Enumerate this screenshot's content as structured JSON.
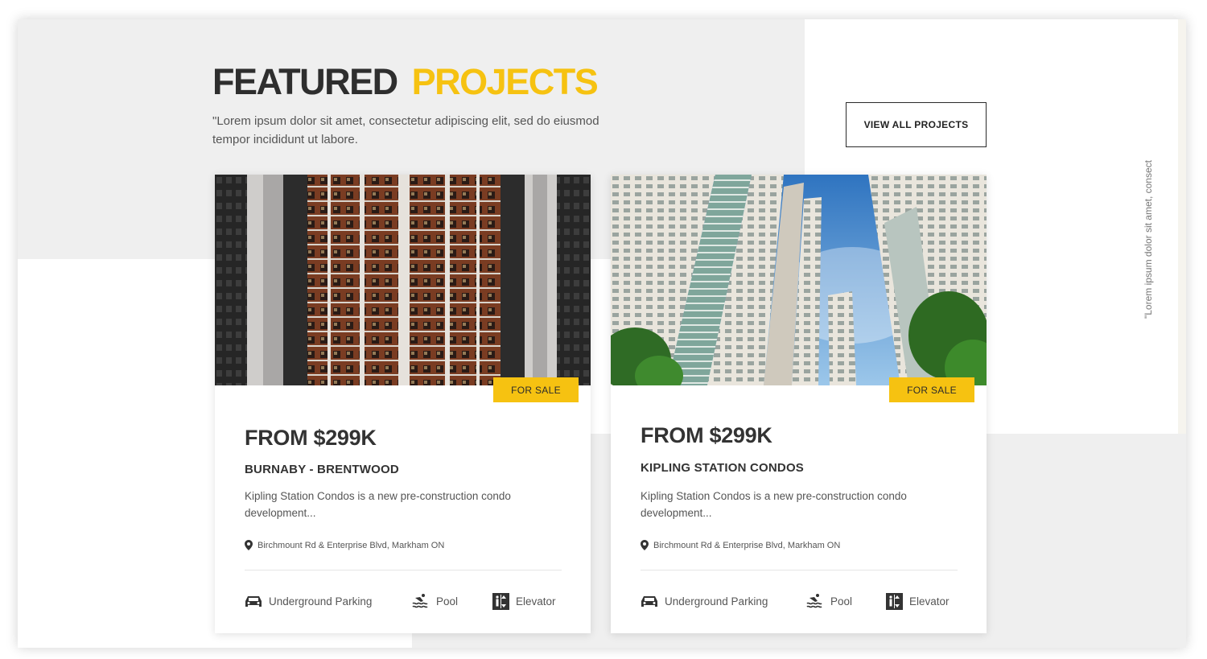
{
  "header": {
    "title_part1": "FEATURED",
    "title_part2": "PROJECTS",
    "subtitle": "\"Lorem ipsum dolor sit amet, consectetur adipiscing elit, sed do eiusmod tempor incididunt ut labore.",
    "view_all_label": "VIEW ALL PROJECTS"
  },
  "side_text": "\"Lorem ipsum dolor sit amet, consect",
  "colors": {
    "accent": "#f6c211",
    "text_dark": "#2e2e2e",
    "panel_gray": "#efefef"
  },
  "cards": [
    {
      "badge": "FOR SALE",
      "price": "FROM $299K",
      "name": "BURNABY - BRENTWOOD",
      "description": "Kipling Station Condos is a new pre-construction condo development...",
      "address": "Birchmount Rd & Enterprise Blvd, Markham ON",
      "amenities": [
        {
          "label": "Underground Parking",
          "icon": "car-icon"
        },
        {
          "label": "Pool",
          "icon": "pool-icon"
        },
        {
          "label": "Elevator",
          "icon": "elevator-icon"
        }
      ]
    },
    {
      "badge": "FOR SALE",
      "price": "FROM $299K",
      "name": "KIPLING STATION CONDOS",
      "description": "Kipling Station Condos is a new pre-construction condo development...",
      "address": "Birchmount Rd & Enterprise Blvd, Markham ON",
      "amenities": [
        {
          "label": "Underground Parking",
          "icon": "car-icon"
        },
        {
          "label": "Pool",
          "icon": "pool-icon"
        },
        {
          "label": "Elevator",
          "icon": "elevator-icon"
        }
      ]
    }
  ]
}
